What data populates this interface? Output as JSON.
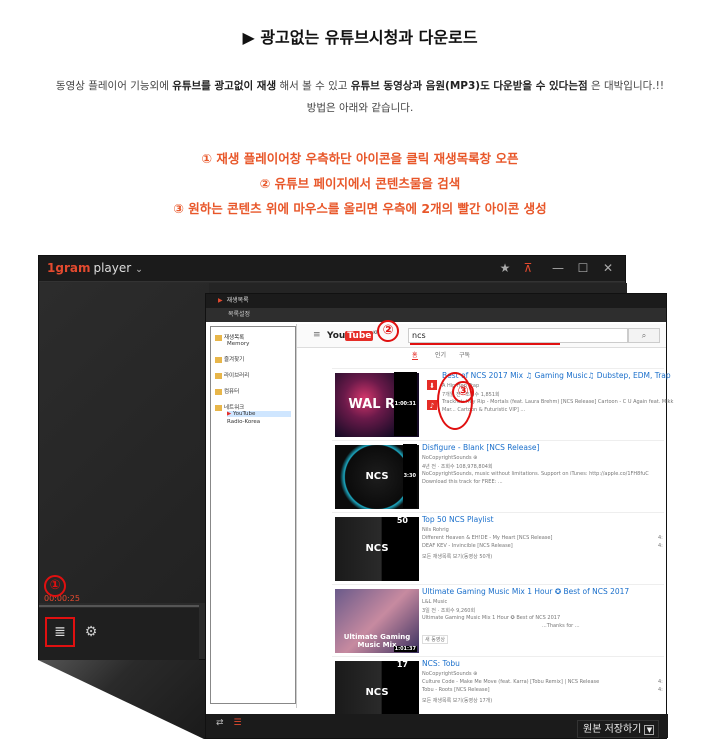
{
  "header": {
    "title": "▶ 광고없는 유튜브시청과 다운로드",
    "desc_parts": [
      "동영상 플레이어 기능외에 ",
      "유튜브를 광고없이 재생",
      " 해서 볼 수 있고 ",
      "유튜브 동영상과 음원(MP3)도 다운받을 수 있다는점",
      " 은 대박입니다.!!"
    ],
    "desc_line2": "방법은 아래와 같습니다.",
    "steps": [
      "① 재생 플레이어창 우측하단 아이콘을 클릭 재생목록창 오픈",
      "② 유튜브 페이지에서 콘텐츠물을 검색",
      "③ 원하는 콘텐츠 위에 마우스를 올리면 우측에 2개의 빨간 아이콘 생성"
    ]
  },
  "player": {
    "logo_num": "1gram",
    "logo_text": "player",
    "chevron": "⌄",
    "timecode": "00:00:25",
    "circle1": "①",
    "icons": {
      "pin": "★",
      "pin2": "📌",
      "minimize": "—",
      "maximize": "☐",
      "close": "✕",
      "list": "≣",
      "gear": "⚙"
    }
  },
  "playlist": {
    "title": "재생목록",
    "sub": "목록설정",
    "tree": [
      "재생목록",
      "Memory",
      "즐겨찾기",
      "라이브러리",
      "컴퓨터",
      "네트워크",
      "YouTube",
      "Radio-Korea"
    ],
    "footer_left": "⇄",
    "footer_right": "☰"
  },
  "youtube": {
    "logo_you": "You",
    "logo_tube": "Tube",
    "logo_kr": "KR",
    "search_value": "ncs",
    "circle2": "②",
    "circle3": "③",
    "tabs": [
      "홈",
      "인기",
      "구독"
    ],
    "videos": [
      {
        "title": "Best of NCS 2017 Mix ♫ Gaming Music♫ Dubstep, EDM, Trap",
        "meta1": "A Hip Hop Trap",
        "meta2": "7개월 전 · 조회수 1,851회",
        "meta3": "Tracklist: Hey Rip - Mortals (feat. Laura Brehm) [NCS Release] Cartoon - C U Again feat. Mikk",
        "meta4": "Mar... Cartoon & Futuristic VIP] ...",
        "thumb": "WAL  RU",
        "dur": "1:00:31"
      },
      {
        "title": "Disfigure - Blank [NCS Release]",
        "meta1": "NoCopyrightSounds ⊕",
        "meta2": "4년 전 · 조회수 108,978,804회",
        "meta3": "NoCopyrightSounds, music without limitations. Support on iTunes: http://apple.co/1FH8fuC",
        "meta4": "Download this track for FREE: ...",
        "thumb": "NCS",
        "dur": "3:30"
      },
      {
        "title": "Top 50 NCS Playlist",
        "meta1": "Nils Rohrig",
        "meta2": "Different Heaven & EH!DE - My Heart [NCS Release]",
        "meta3": "DEAF KEV - Invincible [NCS Release]",
        "meta4": "모든 재생목록 보기(동영상 50개)",
        "thumb": "NCS",
        "dur": "50",
        "right1": "4:",
        "right2": "4:"
      },
      {
        "title": "Ultimate Gaming Music Mix 1 Hour ✪ Best of NCS 2017",
        "meta1": "L&L Music",
        "meta2": "3일 전 · 조회수 9,260회",
        "meta3": "Ultimate Gaming Music Mix 1 Hour ✪ Best of NCS 2017",
        "meta4": "...Thanks for ...",
        "meta5": "새 동영상",
        "thumb": "Ultimate Gaming Music Mix",
        "dur": "1:01:37"
      },
      {
        "title": "NCS: Tobu",
        "meta1": "NoCopyrightSounds ⊕",
        "meta2": "Culture Code - Make Me Move (feat. Karra) [Tobu Remix] | NCS Release",
        "meta3": "Tobu - Roots [NCS Release]",
        "meta4": "모든 재생목록 보기(동영상 17개)",
        "thumb": "NCS",
        "dur": "17",
        "right1": "4:",
        "right2": "4:"
      }
    ],
    "red_icon1": "⬇",
    "red_icon2": "♪"
  },
  "save": {
    "label": "원본 저장하기",
    "dd": "▼"
  },
  "colors": {
    "accent": "#e34a2f",
    "annotation": "#e01010",
    "yt_red": "#e52d27",
    "link": "#1a6fcb"
  }
}
